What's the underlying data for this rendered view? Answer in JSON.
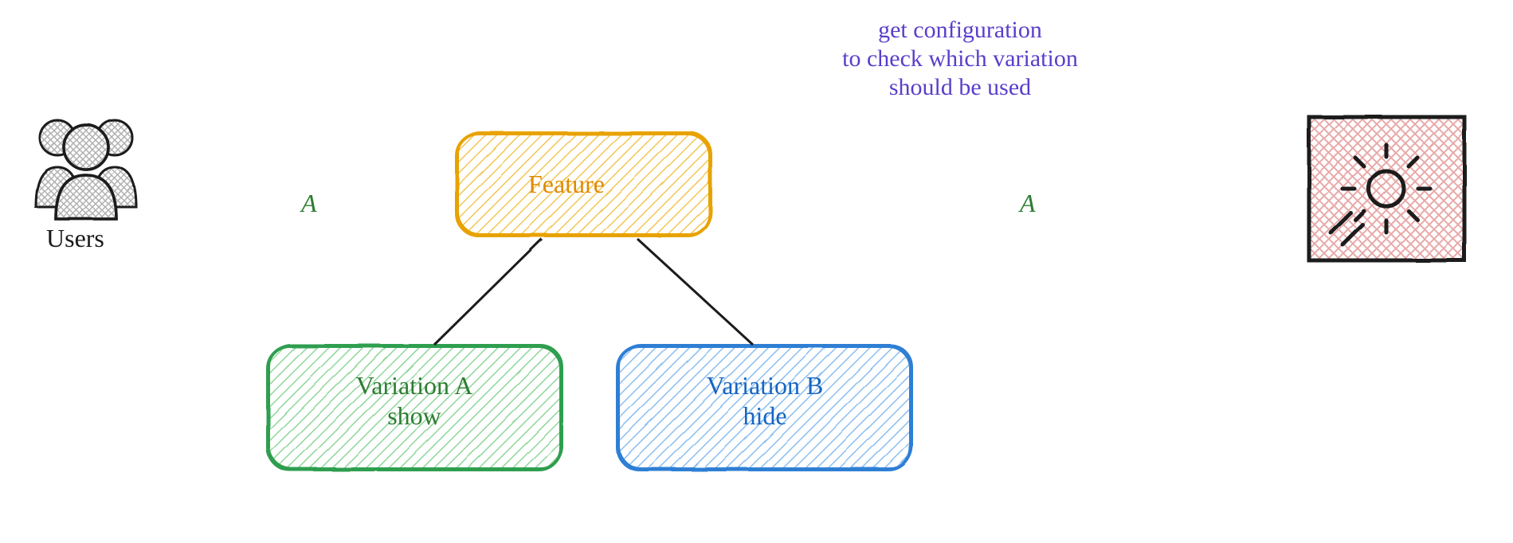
{
  "users": {
    "label": "Users"
  },
  "feature": {
    "label": "Feature"
  },
  "variation_a": {
    "title": "Variation A",
    "subtitle": "show"
  },
  "variation_b": {
    "title": "Variation B",
    "subtitle": "hide"
  },
  "annotation": {
    "line1": "get configuration",
    "line2": "to check which variation",
    "line3": "should be used"
  },
  "return_label_left": "A",
  "return_label_right": "A",
  "colors": {
    "orange_stroke": "#e8a200",
    "orange_fill": "#ffe9a8",
    "green_stroke": "#2e9e4f",
    "green_fill": "#d6f5d6",
    "blue_stroke": "#2d7fd4",
    "blue_fill": "#cfe6ff",
    "purple": "#6a4fd4",
    "pink_fill": "#f7d5d5",
    "black": "#1a1a1a",
    "grey": "#8a8a8a"
  }
}
